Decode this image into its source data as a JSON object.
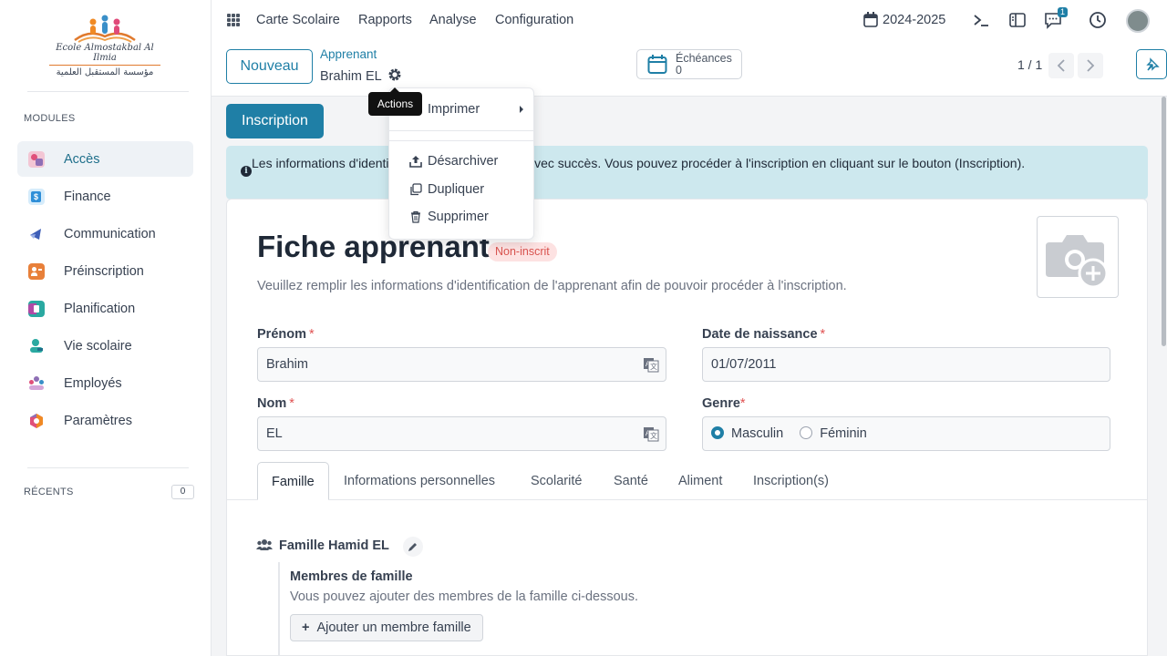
{
  "sidebar": {
    "logo": {
      "line1": "Ecole Almostakbal Al Ilmia",
      "line2": "مؤسسة المستقبل العلمية"
    },
    "modules_title": "MODULES",
    "modules": [
      {
        "label": "Accès",
        "active": true
      },
      {
        "label": "Finance"
      },
      {
        "label": "Communication"
      },
      {
        "label": "Préinscription"
      },
      {
        "label": "Planification"
      },
      {
        "label": "Vie scolaire"
      },
      {
        "label": "Employés"
      },
      {
        "label": "Paramètres"
      }
    ],
    "recents_title": "RÉCENTS",
    "recents_count": "0"
  },
  "topbar": {
    "menu": [
      "Carte Scolaire",
      "Rapports",
      "Analyse",
      "Configuration"
    ],
    "year": "2024-2025",
    "messages_count": "1"
  },
  "control": {
    "new_label": "Nouveau",
    "breadcrumb_parent": "Apprenant",
    "breadcrumb_record": "Brahim EL",
    "tooltip": "Actions",
    "echeances_label": "Échéances",
    "echeances_value": "0",
    "pager": "1 / 1"
  },
  "actions_menu": {
    "items": [
      "Imprimer",
      "Désarchiver",
      "Dupliquer",
      "Supprimer"
    ]
  },
  "main": {
    "inscription_label": "Inscription",
    "alert": "Les informations d'identification ont été remplies avec succès. Vous pouvez procéder à l'inscription en cliquant sur le bouton (Inscription).",
    "title": "Fiche apprenant",
    "status": "Non-inscrit",
    "description": "Veuillez remplir les informations d'identification de l'apprenant afin de pouvoir procéder à l'inscription.",
    "fields": {
      "prenom_label": "Prénom",
      "prenom_value": "Brahim",
      "nom_label": "Nom",
      "nom_value": "EL",
      "date_label": "Date de naissance",
      "date_value": "01/07/2011",
      "genre_label": "Genre",
      "genre_options": [
        "Masculin",
        "Féminin"
      ],
      "genre_selected": "Masculin"
    },
    "tabs": [
      "Famille",
      "Informations personnelles",
      "Scolarité",
      "Santé",
      "Aliment",
      "Inscription(s)"
    ],
    "family": {
      "name": "Famille Hamid EL",
      "members_title": "Membres de famille",
      "members_desc": "Vous pouvez ajouter des membres de la famille ci-dessous.",
      "add_label": "Ajouter un membre famille"
    }
  },
  "colors": {
    "accent": "#1f7fa6",
    "alert_bg": "#cde8ee",
    "status_bg": "#fde2e2",
    "status_fg": "#d9534f"
  }
}
